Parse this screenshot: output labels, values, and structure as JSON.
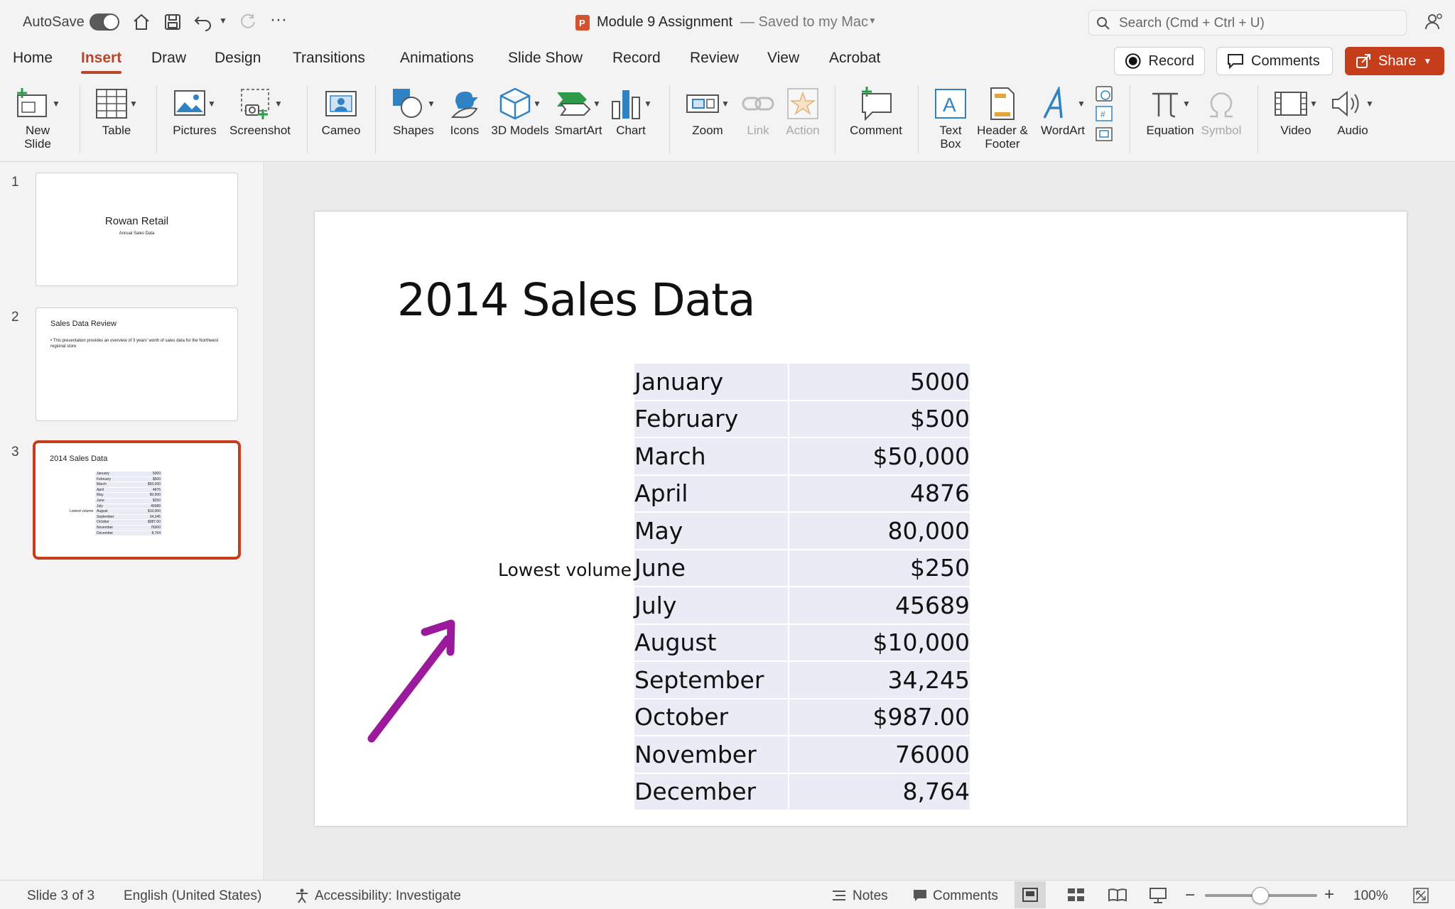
{
  "titlebar": {
    "autosave_label": "AutoSave",
    "doc_title": "Module 9 Assignment",
    "saved_status": "— Saved to my Mac",
    "search_placeholder": "Search (Cmd + Ctrl + U)"
  },
  "tabs": [
    "Home",
    "Insert",
    "Draw",
    "Design",
    "Transitions",
    "Animations",
    "Slide Show",
    "Record",
    "Review",
    "View",
    "Acrobat"
  ],
  "active_tab": "Insert",
  "top_buttons": {
    "record": "Record",
    "comments": "Comments",
    "share": "Share"
  },
  "ribbon": {
    "new_slide": "New Slide",
    "table": "Table",
    "pictures": "Pictures",
    "screenshot": "Screenshot",
    "cameo": "Cameo",
    "shapes": "Shapes",
    "icons": "Icons",
    "models_3d": "3D Models",
    "smartart": "SmartArt",
    "chart": "Chart",
    "zoom": "Zoom",
    "link": "Link",
    "action": "Action",
    "comment": "Comment",
    "text_box": "Text Box",
    "header_footer": "Header & Footer",
    "wordart": "WordArt",
    "equation": "Equation",
    "symbol": "Symbol",
    "video": "Video",
    "audio": "Audio"
  },
  "slides_panel": {
    "numbers": [
      "1",
      "2",
      "3"
    ],
    "slide1": {
      "title": "Rowan Retail",
      "subtitle": "Annual Sales Data"
    },
    "slide2": {
      "title": "Sales Data Review",
      "bullet": "• This presentation provides an overview of 3 years' worth of sales data for the Northwest regional store"
    },
    "slide3": {
      "title": "2014 Sales Data",
      "callout": "Lowest volume"
    }
  },
  "slide": {
    "title": "2014 Sales Data",
    "callout": "Lowest volume",
    "rows": [
      {
        "month": "January",
        "value": "5000"
      },
      {
        "month": "February",
        "value": "$500"
      },
      {
        "month": "March",
        "value": "$50,000"
      },
      {
        "month": "April",
        "value": "4876"
      },
      {
        "month": "May",
        "value": "80,000"
      },
      {
        "month": "June",
        "value": "$250"
      },
      {
        "month": "July",
        "value": "45689"
      },
      {
        "month": "August",
        "value": "$10,000"
      },
      {
        "month": "September",
        "value": "34,245"
      },
      {
        "month": "October",
        "value": "$987.00"
      },
      {
        "month": "November",
        "value": "76000"
      },
      {
        "month": "December",
        "value": "8,764"
      }
    ],
    "arrow_color": "#9b1a9b"
  },
  "statusbar": {
    "slide_info": "Slide 3 of 3",
    "language": "English (United States)",
    "accessibility": "Accessibility: Investigate",
    "notes": "Notes",
    "comments": "Comments",
    "zoom": "100%"
  },
  "colors": {
    "accent": "#b7472a",
    "share": "#c43e1c",
    "table_fill": "#e9ebf5"
  }
}
